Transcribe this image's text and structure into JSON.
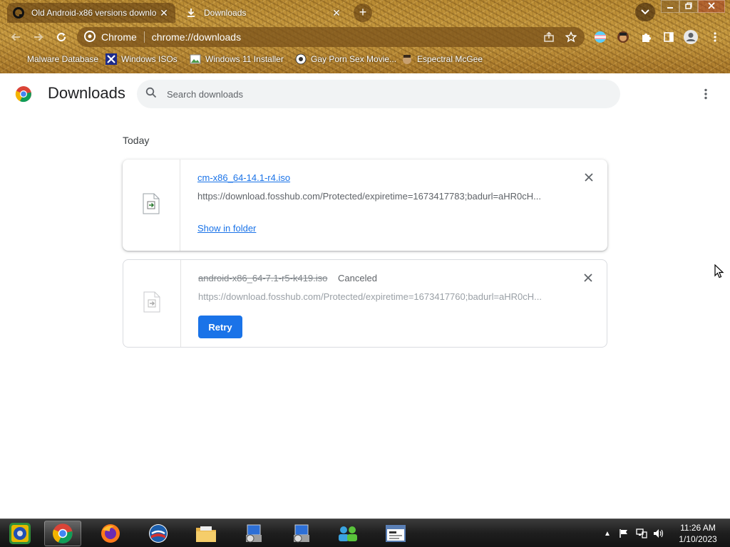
{
  "browser": {
    "tabs": [
      {
        "title": "Old Android-x86 versions downlo",
        "favicon": "circle-logo-icon",
        "active": false
      },
      {
        "title": "Downloads",
        "favicon": "download-icon",
        "active": true
      }
    ],
    "omnibox": {
      "site_chip": "Chrome",
      "url": "chrome://downloads"
    },
    "bookmarks": [
      {
        "label": "Malware Database",
        "icon": "folder-icon"
      },
      {
        "label": "Windows ISOs",
        "icon": "x-logo-icon"
      },
      {
        "label": "Windows 11 Installer",
        "icon": "image-icon"
      },
      {
        "label": "Gay Porn Sex Movie...",
        "icon": "badge-icon"
      },
      {
        "label": "Espectral McGee",
        "icon": "face-icon"
      }
    ]
  },
  "downloads": {
    "title": "Downloads",
    "search_placeholder": "Search downloads",
    "section_label": "Today",
    "items": [
      {
        "filename": "cm-x86_64-14.1-r4.iso",
        "url": "https://download.fosshub.com/Protected/expiretime=1673417783;badurl=aHR0cH...",
        "action": "Show in folder",
        "status": ""
      },
      {
        "filename": "android-x86_64-7.1-r5-k419.iso",
        "url": "https://download.fosshub.com/Protected/expiretime=1673417760;badurl=aHR0cH...",
        "action": "Retry",
        "status": "Canceled"
      }
    ]
  },
  "taskbar": {
    "time": "11:26 AM",
    "date": "1/10/2023",
    "apps": [
      "start-orb",
      "chrome",
      "firefox",
      "obama-logo",
      "file-explorer",
      "setup-installer-1",
      "setup-installer-2",
      "network-users",
      "web-window"
    ]
  },
  "colors": {
    "accent": "#1a73e8",
    "frame": "#b7872c",
    "taskbar": "#1e1e1e"
  }
}
